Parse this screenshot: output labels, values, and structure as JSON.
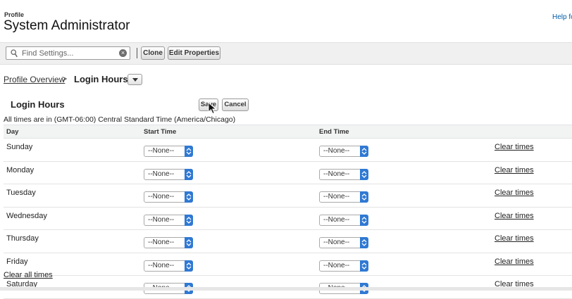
{
  "header": {
    "profile_label": "Profile",
    "title": "System Administrator",
    "help_link": "Help fo"
  },
  "toolbar": {
    "search_placeholder": "Find Settings...",
    "clone_label": "Clone",
    "edit_properties_label": "Edit Properties"
  },
  "breadcrumb": {
    "parent": "Profile Overview",
    "separator": ">",
    "current": "Login Hours"
  },
  "login_hours": {
    "title": "Login Hours",
    "save_label": "Save",
    "cancel_label": "Cancel",
    "timezone_note": "All times are in (GMT-06:00) Central Standard Time (America/Chicago)",
    "columns": {
      "day": "Day",
      "start": "Start Time",
      "end": "End Time"
    },
    "rows": [
      {
        "day": "Sunday",
        "start": "--None--",
        "end": "--None--",
        "clear": "Clear times"
      },
      {
        "day": "Monday",
        "start": "--None--",
        "end": "--None--",
        "clear": "Clear times"
      },
      {
        "day": "Tuesday",
        "start": "--None--",
        "end": "--None--",
        "clear": "Clear times"
      },
      {
        "day": "Wednesday",
        "start": "--None--",
        "end": "--None--",
        "clear": "Clear times"
      },
      {
        "day": "Thursday",
        "start": "--None--",
        "end": "--None--",
        "clear": "Clear times"
      },
      {
        "day": "Friday",
        "start": "--None--",
        "end": "--None--",
        "clear": "Clear times"
      },
      {
        "day": "Saturday",
        "start": "--None--",
        "end": "--None--",
        "clear": "Clear times"
      }
    ],
    "clear_all_label": "Clear all times"
  },
  "colors": {
    "select_stepper": "#2f79d3",
    "header_row_bg": "#f2f3f3",
    "link": "#015ba7"
  },
  "icons": [
    "search-icon",
    "clear-search-icon",
    "chevron-down-icon",
    "stepper-icon",
    "mouse-cursor-icon"
  ]
}
